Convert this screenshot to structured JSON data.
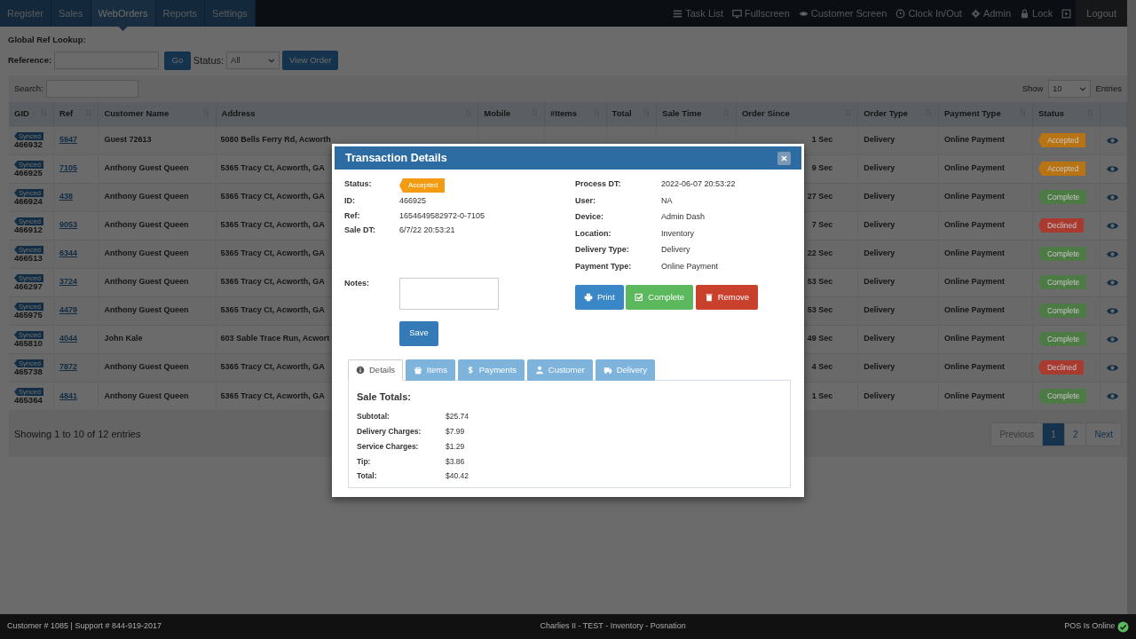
{
  "nav": {
    "tabs": [
      {
        "label": "Register",
        "selected": false
      },
      {
        "label": "Sales",
        "selected": false
      },
      {
        "label": "WebOrders",
        "selected": true
      },
      {
        "label": "Reports",
        "selected": false
      },
      {
        "label": "Settings",
        "selected": false
      }
    ],
    "tools": [
      {
        "label": "Task List"
      },
      {
        "label": "Fullscreen"
      },
      {
        "label": "Customer Screen"
      },
      {
        "label": "Clock In/Out"
      },
      {
        "label": "Admin"
      },
      {
        "label": "Lock"
      }
    ],
    "logout": "Logout"
  },
  "lookup": {
    "title": "Global Ref Lookup:",
    "reference_label": "Reference:",
    "go": "Go",
    "status_label": "Status:",
    "status_value": "All",
    "view_order": "View Order"
  },
  "table": {
    "search_label": "Search:",
    "show_label": "Show",
    "show_value": "10",
    "entries_label": "Entries",
    "columns": [
      "GID",
      "Ref",
      "Customer Name",
      "Address",
      "Mobile",
      "#Items",
      "Total",
      "Sale Time",
      "Order Since",
      "Order Type",
      "Payment Type",
      "Status"
    ],
    "rows": [
      {
        "sync": "Synced",
        "gid": "466932",
        "ref": "5947",
        "customer": "Guest 72613",
        "address": "5080 Bells Ferry Rd, Acworth",
        "since": "1 Sec",
        "order_type": "Delivery",
        "payment_type": "Online Payment",
        "status": {
          "label": "Accepted",
          "color": "#b87412"
        }
      },
      {
        "sync": "Synced",
        "gid": "466925",
        "ref": "7105",
        "customer": "Anthony Guest Queen",
        "address": "5365 Tracy Ct, Acworth, GA",
        "since": "9 Sec",
        "order_type": "Delivery",
        "payment_type": "Online Payment",
        "status": {
          "label": "Accepted",
          "color": "#b87412"
        }
      },
      {
        "sync": "Synced",
        "gid": "466924",
        "ref": "438",
        "customer": "Anthony Guest Queen",
        "address": "5365 Tracy Ct, Acworth, GA",
        "since": "27 Sec",
        "order_type": "Delivery",
        "payment_type": "Online Payment",
        "status": {
          "label": "Complete",
          "color": "#4e7a45"
        }
      },
      {
        "sync": "Synced",
        "gid": "466912",
        "ref": "9053",
        "customer": "Anthony Guest Queen",
        "address": "5365 Tracy Ct, Acworth, GA",
        "since": "7 Sec",
        "order_type": "Delivery",
        "payment_type": "Online Payment",
        "status": {
          "label": "Declined",
          "color": "#a83a30"
        }
      },
      {
        "sync": "Synced",
        "gid": "466513",
        "ref": "6344",
        "customer": "Anthony Guest Queen",
        "address": "5365 Tracy Ct, Acworth, GA",
        "since": "22 Sec",
        "order_type": "Delivery",
        "payment_type": "Online Payment",
        "status": {
          "label": "Complete",
          "color": "#4e7a45"
        }
      },
      {
        "sync": "Synced",
        "gid": "466297",
        "ref": "3724",
        "customer": "Anthony Guest Queen",
        "address": "5365 Tracy Ct, Acworth, GA",
        "since": "53 Sec",
        "order_type": "Delivery",
        "payment_type": "Online Payment",
        "status": {
          "label": "Complete",
          "color": "#4e7a45"
        }
      },
      {
        "sync": "Synced",
        "gid": "465975",
        "ref": "4479",
        "customer": "Anthony Guest Queen",
        "address": "5365 Tracy Ct, Acworth, GA",
        "since": "53 Sec",
        "order_type": "Delivery",
        "payment_type": "Online Payment",
        "status": {
          "label": "Complete",
          "color": "#4e7a45"
        }
      },
      {
        "sync": "Synced",
        "gid": "465810",
        "ref": "4044",
        "customer": "John Kale",
        "address": "603 Sable Trace Run, Acwort",
        "since": "49 Sec",
        "order_type": "Delivery",
        "payment_type": "Online Payment",
        "status": {
          "label": "Complete",
          "color": "#4e7a45"
        }
      },
      {
        "sync": "Synced",
        "gid": "465738",
        "ref": "7872",
        "customer": "Anthony Guest Queen",
        "address": "5365 Tracy Ct, Acworth, GA",
        "since": "4 Sec",
        "order_type": "Delivery",
        "payment_type": "Online Payment",
        "status": {
          "label": "Declined",
          "color": "#a83a30"
        }
      },
      {
        "sync": "Synced",
        "gid": "465364",
        "ref": "4841",
        "customer": "Anthony Guest Queen",
        "address": "5365 Tracy Ct, Acworth, GA",
        "since": "1 Sec",
        "order_type": "Delivery",
        "payment_type": "Online Payment",
        "status": {
          "label": "Complete",
          "color": "#4e7a45"
        }
      }
    ],
    "info": "Showing 1 to 10 of 12 entries",
    "pagination": [
      {
        "label": "Previous",
        "selected": false,
        "disabled": true
      },
      {
        "label": "1",
        "selected": true,
        "disabled": false
      },
      {
        "label": "2",
        "selected": false,
        "disabled": false
      },
      {
        "label": "Next",
        "selected": false,
        "disabled": false
      }
    ]
  },
  "modal": {
    "title": "Transaction Details",
    "left": [
      {
        "label": "Status:",
        "value": "Accepted",
        "kind": "badge",
        "color": "#f39c12"
      },
      {
        "label": "ID:",
        "value": "466925",
        "kind": "text"
      },
      {
        "label": "Ref:",
        "value": "1654649582972-0-7105",
        "kind": "text"
      },
      {
        "label": "Sale DT:",
        "value": "6/7/22 20:53:21",
        "kind": "text"
      }
    ],
    "right": [
      {
        "label": "Process DT:",
        "value": "2022-06-07 20:53:22"
      },
      {
        "label": "User:",
        "value": "NA"
      },
      {
        "label": "Device:",
        "value": "Admin Dash"
      },
      {
        "label": "Location:",
        "value": "Inventory"
      },
      {
        "label": "Delivery Type:",
        "value": "Delivery"
      },
      {
        "label": "Payment Type:",
        "value": "Online Payment"
      }
    ],
    "notes_label": "Notes:",
    "save": "Save",
    "actions": [
      {
        "label": "Print",
        "kind": "primary"
      },
      {
        "label": "Complete",
        "kind": "success"
      },
      {
        "label": "Remove",
        "kind": "danger"
      }
    ],
    "tabs": [
      {
        "label": "Details",
        "selected": true
      },
      {
        "label": "Items",
        "selected": false
      },
      {
        "label": "Payments",
        "selected": false
      },
      {
        "label": "Customer",
        "selected": false
      },
      {
        "label": "Delivery",
        "selected": false
      }
    ],
    "section_title": "Sale Totals:",
    "totals": [
      {
        "label": "Subtotal:",
        "value": "$25.74"
      },
      {
        "label": "Delivery Charges:",
        "value": "$7.99"
      },
      {
        "label": "Service Charges:",
        "value": "$1.29"
      },
      {
        "label": "Tip:",
        "value": "$3.86"
      },
      {
        "label": "Total:",
        "value": "$40.42"
      }
    ]
  },
  "footer": {
    "left": "Customer # 1085 | Support # 844-919-2017",
    "center": "Charlies II - TEST - Inventory - Posnation",
    "right": "POS Is Online"
  }
}
